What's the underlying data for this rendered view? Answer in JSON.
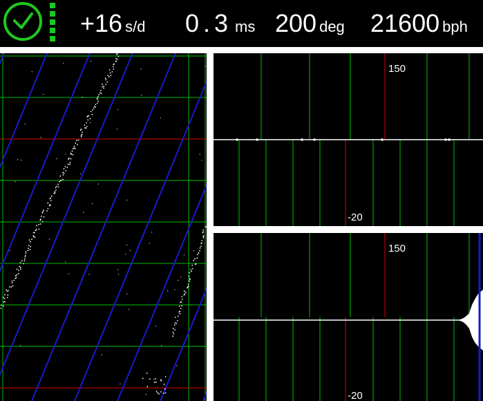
{
  "header": {
    "status_icon": "clock-check-icon",
    "metrics": [
      {
        "id": "rate",
        "value": "+16",
        "unit": "s/d"
      },
      {
        "id": "beat-error",
        "value": "0.3",
        "unit": "ms"
      },
      {
        "id": "amplitude",
        "value": "200",
        "unit": "deg"
      },
      {
        "id": "beat-rate",
        "value": "21600",
        "unit": "bph"
      }
    ]
  },
  "waveform_top": {
    "max_label": "150",
    "min_label": "-20"
  },
  "waveform_bottom": {
    "max_label": "150",
    "min_label": "-20"
  },
  "colors": {
    "status_green": "#1ec81e",
    "grid_green": "#00c000",
    "ref_red": "#e00000",
    "rate_blue": "#1a1acc",
    "trace": "#ffffff",
    "background": "#000000"
  }
}
